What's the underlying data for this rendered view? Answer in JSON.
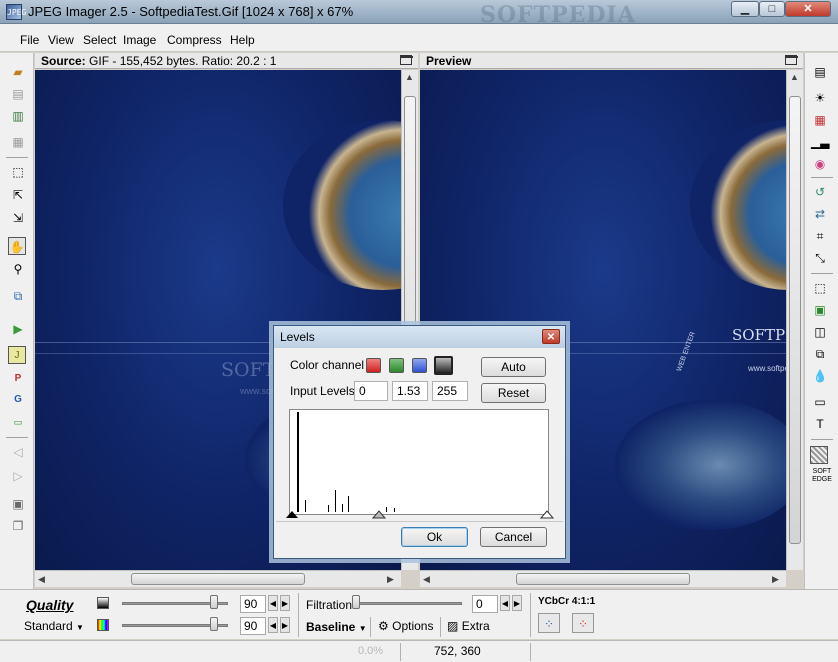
{
  "window": {
    "title": "JPEG Imager 2.5 - SoftpediaTest.Gif [1024 x 768] x 67%",
    "watermark": "SOFTPEDIA",
    "logo_text": "JPEG",
    "minimize": "▁",
    "maximize": "□",
    "close": "✕"
  },
  "menu": [
    "File",
    "View",
    "Select",
    "Image",
    "Compress",
    "Help"
  ],
  "source_panel": {
    "label": "Source:",
    "info": "GIF - 155,452 bytes. Ratio: 20.2 : 1"
  },
  "preview_panel": {
    "label": "Preview"
  },
  "image_overlay": {
    "brand": "SOFTPEDIA",
    "brand_preview": "SOFTPE",
    "url": "www.softpe",
    "url_preview": "www.softpe",
    "arc_text": "WEB ENTER"
  },
  "levels_dialog": {
    "title": "Levels",
    "color_channel_label": "Color channel",
    "input_levels_label": "Input Levels",
    "input_levels": [
      "0",
      "1.53",
      "255"
    ],
    "auto_button": "Auto",
    "reset_button": "Reset",
    "ok_button": "Ok",
    "cancel_button": "Cancel",
    "channels": [
      {
        "name": "red",
        "color": "#e84040"
      },
      {
        "name": "green",
        "color": "#3a9a3a"
      },
      {
        "name": "blue",
        "color": "#4a6ae0"
      },
      {
        "name": "gray",
        "color": "#4a4a4a"
      }
    ]
  },
  "bottom_panel": {
    "quality_label": "Quality",
    "standard_label": "Standard",
    "quality_value_1": "90",
    "quality_value_2": "90",
    "filtration_label": "Filtration",
    "filtration_value": "0",
    "baseline_label": "Baseline",
    "options_label": "Options",
    "extra_label": "Extra",
    "ycbcr_label": "YCbCr 4:1:1"
  },
  "right_toolbar": {
    "soft_edge_label": "SOFT EDGE"
  },
  "status": {
    "zoom": "0.0%",
    "coords": "752, 360"
  },
  "icons": {
    "open": "📂",
    "close_doc": "▤",
    "print": "⎙",
    "save": "▦",
    "select": "⬚",
    "hand": "✋",
    "zoom": "🔍"
  }
}
